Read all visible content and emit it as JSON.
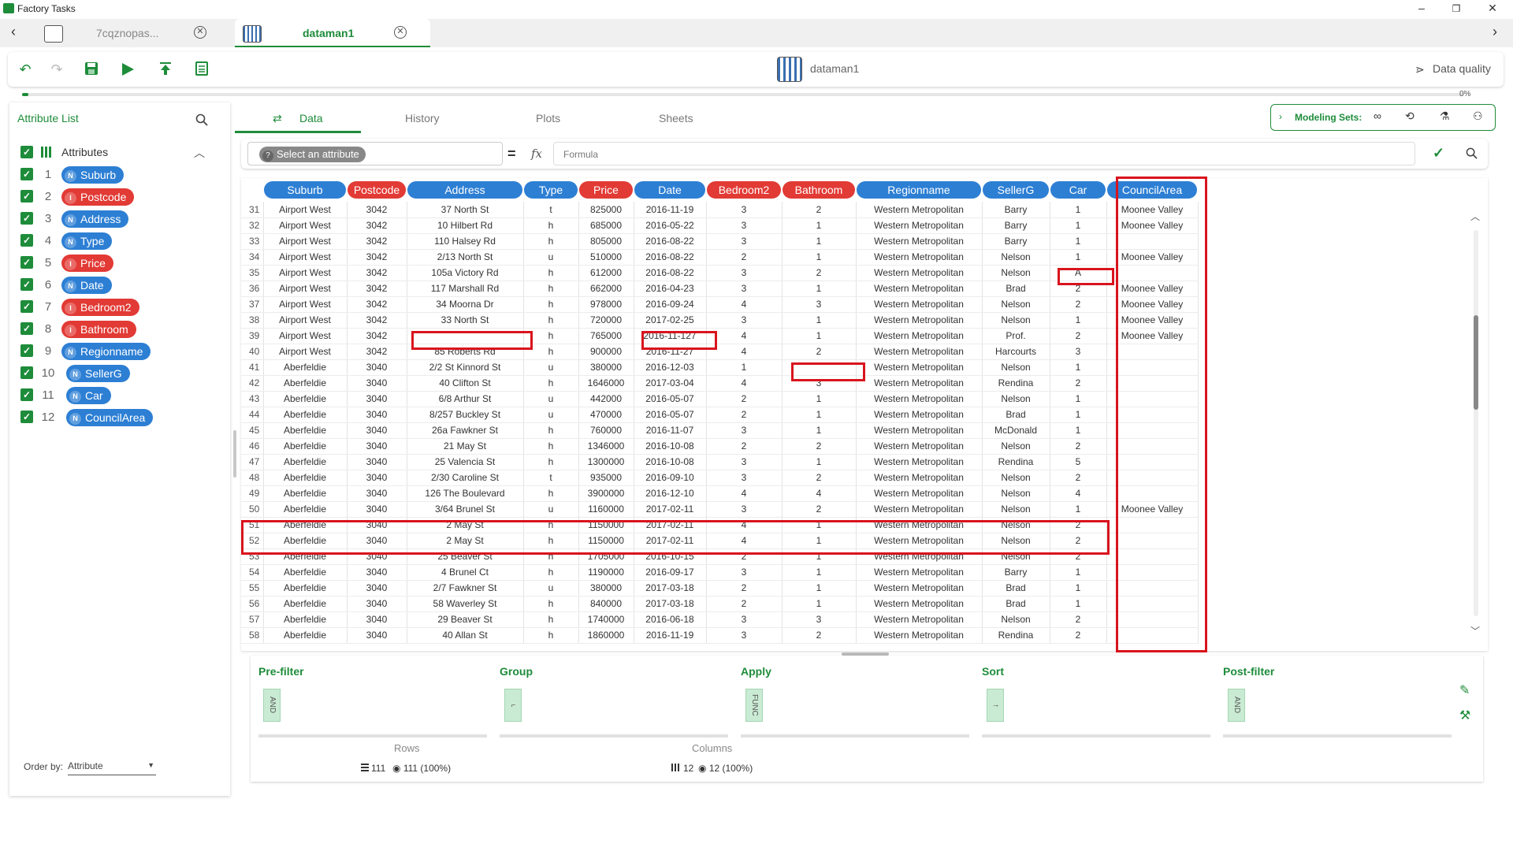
{
  "window": {
    "title": "Factory Tasks",
    "controls": [
      "–",
      "❐",
      "✕"
    ]
  },
  "tabs": [
    {
      "label": "7cqznopas...",
      "active": false
    },
    {
      "label": "dataman1",
      "active": true
    }
  ],
  "toolbar": {
    "center_title": "dataman1",
    "data_quality_label": "Data quality",
    "progress_label": "0%",
    "progress_fraction": 0.0
  },
  "attribute_panel": {
    "title": "Attribute List",
    "group_label": "Attributes",
    "order_by_label": "Order by:",
    "order_by_value": "Attribute",
    "items": [
      {
        "num": "1",
        "type": "N",
        "name": "Suburb",
        "color": "#2d7fd4"
      },
      {
        "num": "2",
        "type": "I",
        "name": "Postcode",
        "color": "#e23a35"
      },
      {
        "num": "3",
        "type": "N",
        "name": "Address",
        "color": "#2d7fd4"
      },
      {
        "num": "4",
        "type": "N",
        "name": "Type",
        "color": "#2d7fd4"
      },
      {
        "num": "5",
        "type": "I",
        "name": "Price",
        "color": "#e23a35"
      },
      {
        "num": "6",
        "type": "N",
        "name": "Date",
        "color": "#2d7fd4"
      },
      {
        "num": "7",
        "type": "I",
        "name": "Bedroom2",
        "color": "#e23a35"
      },
      {
        "num": "8",
        "type": "I",
        "name": "Bathroom",
        "color": "#e23a35"
      },
      {
        "num": "9",
        "type": "N",
        "name": "Regionname",
        "color": "#2d7fd4"
      },
      {
        "num": "10",
        "type": "N",
        "name": "SellerG",
        "color": "#2d7fd4"
      },
      {
        "num": "11",
        "type": "N",
        "name": "Car",
        "color": "#2d7fd4"
      },
      {
        "num": "12",
        "type": "N",
        "name": "CouncilArea",
        "color": "#2d7fd4"
      }
    ]
  },
  "main_tabs": [
    {
      "label": "Data",
      "active": true
    },
    {
      "label": "History",
      "active": false
    },
    {
      "label": "Plots",
      "active": false
    },
    {
      "label": "Sheets",
      "active": false
    }
  ],
  "modeling_sets_label": "Modeling Sets:",
  "formula": {
    "select_attribute": "Select an attribute",
    "equals": "=",
    "fx": "fx",
    "placeholder": "Formula"
  },
  "table": {
    "columns": [
      {
        "name": "Suburb",
        "color": "#2d7fd4"
      },
      {
        "name": "Postcode",
        "color": "#e23a35"
      },
      {
        "name": "Address",
        "color": "#2d7fd4"
      },
      {
        "name": "Type",
        "color": "#2d7fd4"
      },
      {
        "name": "Price",
        "color": "#e23a35"
      },
      {
        "name": "Date",
        "color": "#2d7fd4"
      },
      {
        "name": "Bedroom2",
        "color": "#e23a35"
      },
      {
        "name": "Bathroom",
        "color": "#e23a35"
      },
      {
        "name": "Regionname",
        "color": "#2d7fd4"
      },
      {
        "name": "SellerG",
        "color": "#2d7fd4"
      },
      {
        "name": "Car",
        "color": "#2d7fd4"
      },
      {
        "name": "CouncilArea",
        "color": "#2d7fd4"
      }
    ],
    "rows": [
      [
        "31",
        "Airport West",
        "3042",
        "37 North St",
        "t",
        "825000",
        "2016-11-19",
        "3",
        "2",
        "Western Metropolitan",
        "Barry",
        "1",
        "Moonee Valley"
      ],
      [
        "32",
        "Airport West",
        "3042",
        "10 Hilbert Rd",
        "h",
        "685000",
        "2016-05-22",
        "3",
        "1",
        "Western Metropolitan",
        "Barry",
        "1",
        "Moonee Valley"
      ],
      [
        "33",
        "Airport West",
        "3042",
        "110 Halsey Rd",
        "h",
        "805000",
        "2016-08-22",
        "3",
        "1",
        "Western Metropolitan",
        "Barry",
        "1",
        ""
      ],
      [
        "34",
        "Airport West",
        "3042",
        "2/13 North St",
        "u",
        "510000",
        "2016-08-22",
        "2",
        "1",
        "Western Metropolitan",
        "Nelson",
        "1",
        "Moonee Valley"
      ],
      [
        "35",
        "Airport West",
        "3042",
        "105a Victory Rd",
        "h",
        "612000",
        "2016-08-22",
        "3",
        "2",
        "Western Metropolitan",
        "Nelson",
        "A",
        ""
      ],
      [
        "36",
        "Airport West",
        "3042",
        "117 Marshall Rd",
        "h",
        "662000",
        "2016-04-23",
        "3",
        "1",
        "Western Metropolitan",
        "Brad",
        "2",
        "Moonee Valley"
      ],
      [
        "37",
        "Airport West",
        "3042",
        "34 Moorna Dr",
        "h",
        "978000",
        "2016-09-24",
        "4",
        "3",
        "Western Metropolitan",
        "Nelson",
        "2",
        "Moonee Valley"
      ],
      [
        "38",
        "Airport West",
        "3042",
        "33 North St",
        "h",
        "720000",
        "2017-02-25",
        "3",
        "1",
        "Western Metropolitan",
        "Nelson",
        "1",
        "Moonee Valley"
      ],
      [
        "39",
        "Airport West",
        "3042",
        "",
        "h",
        "765000",
        "2016-11-127",
        "4",
        "1",
        "Western Metropolitan",
        "Prof.",
        "2",
        "Moonee Valley"
      ],
      [
        "40",
        "Airport West",
        "3042",
        "85 Roberts Rd",
        "h",
        "900000",
        "2016-11-27",
        "4",
        "2",
        "Western Metropolitan",
        "Harcourts",
        "3",
        ""
      ],
      [
        "41",
        "Aberfeldie",
        "3040",
        "2/2 St Kinnord St",
        "u",
        "380000",
        "2016-12-03",
        "1",
        "",
        "Western Metropolitan",
        "Nelson",
        "1",
        ""
      ],
      [
        "42",
        "Aberfeldie",
        "3040",
        "40 Clifton St",
        "h",
        "1646000",
        "2017-03-04",
        "4",
        "3",
        "Western Metropolitan",
        "Rendina",
        "2",
        ""
      ],
      [
        "43",
        "Aberfeldie",
        "3040",
        "6/8 Arthur St",
        "u",
        "442000",
        "2016-05-07",
        "2",
        "1",
        "Western Metropolitan",
        "Nelson",
        "1",
        ""
      ],
      [
        "44",
        "Aberfeldie",
        "3040",
        "8/257 Buckley St",
        "u",
        "470000",
        "2016-05-07",
        "2",
        "1",
        "Western Metropolitan",
        "Brad",
        "1",
        ""
      ],
      [
        "45",
        "Aberfeldie",
        "3040",
        "26a Fawkner St",
        "h",
        "760000",
        "2016-11-07",
        "3",
        "1",
        "Western Metropolitan",
        "McDonald",
        "1",
        ""
      ],
      [
        "46",
        "Aberfeldie",
        "3040",
        "21 May St",
        "h",
        "1346000",
        "2016-10-08",
        "2",
        "2",
        "Western Metropolitan",
        "Nelson",
        "2",
        ""
      ],
      [
        "47",
        "Aberfeldie",
        "3040",
        "25 Valencia St",
        "h",
        "1300000",
        "2016-10-08",
        "3",
        "1",
        "Western Metropolitan",
        "Rendina",
        "5",
        ""
      ],
      [
        "48",
        "Aberfeldie",
        "3040",
        "2/30 Caroline St",
        "t",
        "935000",
        "2016-09-10",
        "3",
        "2",
        "Western Metropolitan",
        "Nelson",
        "2",
        ""
      ],
      [
        "49",
        "Aberfeldie",
        "3040",
        "126 The Boulevard",
        "h",
        "3900000",
        "2016-12-10",
        "4",
        "4",
        "Western Metropolitan",
        "Nelson",
        "4",
        ""
      ],
      [
        "50",
        "Aberfeldie",
        "3040",
        "3/64 Brunel St",
        "u",
        "1160000",
        "2017-02-11",
        "3",
        "2",
        "Western Metropolitan",
        "Nelson",
        "1",
        "Moonee Valley"
      ],
      [
        "51",
        "Aberfeldie",
        "3040",
        "2 May St",
        "h",
        "1150000",
        "2017-02-11",
        "4",
        "1",
        "Western Metropolitan",
        "Nelson",
        "2",
        ""
      ],
      [
        "52",
        "Aberfeldie",
        "3040",
        "2 May St",
        "h",
        "1150000",
        "2017-02-11",
        "4",
        "1",
        "Western Metropolitan",
        "Nelson",
        "2",
        ""
      ],
      [
        "53",
        "Aberfeldie",
        "3040",
        "25 Beaver St",
        "h",
        "1705000",
        "2016-10-15",
        "2",
        "1",
        "Western Metropolitan",
        "Nelson",
        "2",
        ""
      ],
      [
        "54",
        "Aberfeldie",
        "3040",
        "4 Brunel Ct",
        "h",
        "1190000",
        "2016-09-17",
        "3",
        "1",
        "Western Metropolitan",
        "Barry",
        "1",
        ""
      ],
      [
        "55",
        "Aberfeldie",
        "3040",
        "2/7 Fawkner St",
        "u",
        "380000",
        "2017-03-18",
        "2",
        "1",
        "Western Metropolitan",
        "Brad",
        "1",
        ""
      ],
      [
        "56",
        "Aberfeldie",
        "3040",
        "58 Waverley St",
        "h",
        "840000",
        "2017-03-18",
        "2",
        "1",
        "Western Metropolitan",
        "Brad",
        "1",
        ""
      ],
      [
        "57",
        "Aberfeldie",
        "3040",
        "29 Beaver St",
        "h",
        "1740000",
        "2016-06-18",
        "3",
        "3",
        "Western Metropolitan",
        "Nelson",
        "2",
        ""
      ],
      [
        "58",
        "Aberfeldie",
        "3040",
        "40 Allan St",
        "h",
        "1860000",
        "2016-11-19",
        "3",
        "2",
        "Western Metropolitan",
        "Rendina",
        "2",
        ""
      ]
    ]
  },
  "pipeline": {
    "stages": [
      {
        "title": "Pre-filter",
        "handle": "AND"
      },
      {
        "title": "Group",
        "handle": "⌐"
      },
      {
        "title": "Apply",
        "handle": "FUNC"
      },
      {
        "title": "Sort",
        "handle": "↑"
      },
      {
        "title": "Post-filter",
        "handle": "AND"
      }
    ],
    "rows_label": "Rows",
    "rows_total": "111",
    "rows_visible": "111 (100%)",
    "columns_label": "Columns",
    "columns_total": "12",
    "columns_visible": "12 (100%)"
  }
}
